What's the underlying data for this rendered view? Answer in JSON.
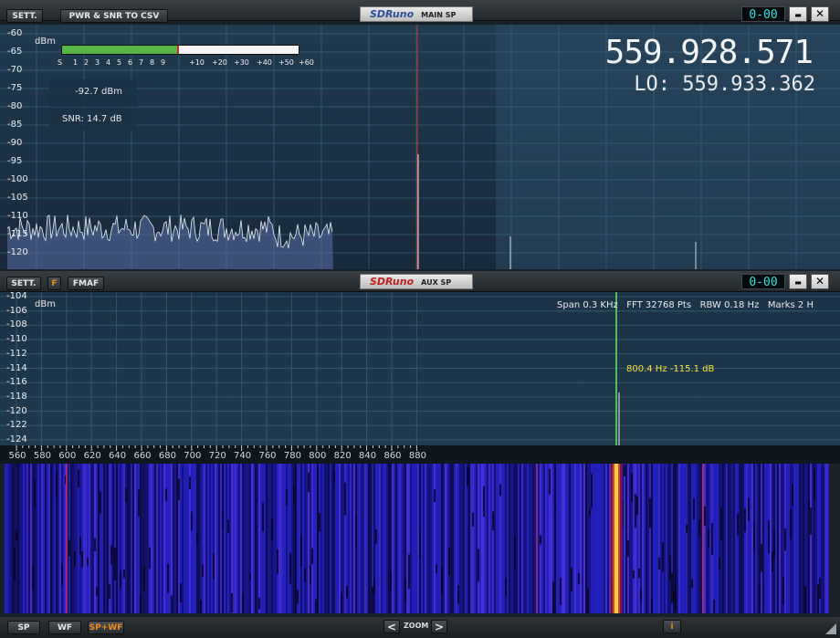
{
  "main": {
    "settings_label": "SETT.",
    "csv_button_label": "PWR & SNR TO CSV",
    "brand": "SDRuno",
    "window_title": "MAIN SP",
    "lcd": "0-00",
    "minimize": "▬",
    "close": "✕",
    "y_unit": "dBm",
    "y_ticks": [
      "-60",
      "-65",
      "-70",
      "-75",
      "-80",
      "-85",
      "-90",
      "-95",
      "-100",
      "-105",
      "-110",
      "-115",
      "-120"
    ],
    "meter_scale": [
      "S",
      "1",
      "2",
      "3",
      "4",
      "5",
      "6",
      "7",
      "8",
      "9",
      "+10",
      "+20",
      "+30",
      "+40",
      "+50",
      "+60"
    ],
    "meter_level_fraction": 0.485,
    "power_readout": "-92.7 dBm",
    "snr_readout": "SNR: 14.7 dB",
    "frequency": "559.928.571",
    "lo_frequency": "LO: 559.933.362"
  },
  "aux": {
    "settings_label": "SETT.",
    "f_label": "F",
    "mode_label": "FMAF",
    "brand": "SDRuno",
    "window_title": "AUX SP",
    "lcd": "0-00",
    "minimize": "▬",
    "close": "✕",
    "y_unit": "dBm",
    "y_ticks": [
      "-104",
      "-106",
      "-108",
      "-110",
      "-112",
      "-114",
      "-116",
      "-118",
      "-120",
      "-122",
      "-124"
    ],
    "info_line": "Span 0.3 KHz   FFT 32768 Pts   RBW 0.18 Hz   Marks 2 H",
    "marker_readout": "800.4 Hz -115.1 dB",
    "x_ticks": [
      "560",
      "580",
      "600",
      "620",
      "640",
      "660",
      "680",
      "700",
      "720",
      "740",
      "760",
      "780",
      "800",
      "820",
      "840",
      "860",
      "880"
    ]
  },
  "bottom": {
    "sp": "SP",
    "wf": "WF",
    "spwf": "SP+WF",
    "zoom_left": "<",
    "zoom_label": "ZOOM",
    "zoom_right": ">",
    "info": "i"
  },
  "colors": {
    "accent_orange": "#f08a1a",
    "meter_green": "#56b648",
    "lcd_cyan": "#2fe0e0",
    "marker_yellow": "#f5e33a",
    "waterfall_blue": "#1c1ba8"
  }
}
